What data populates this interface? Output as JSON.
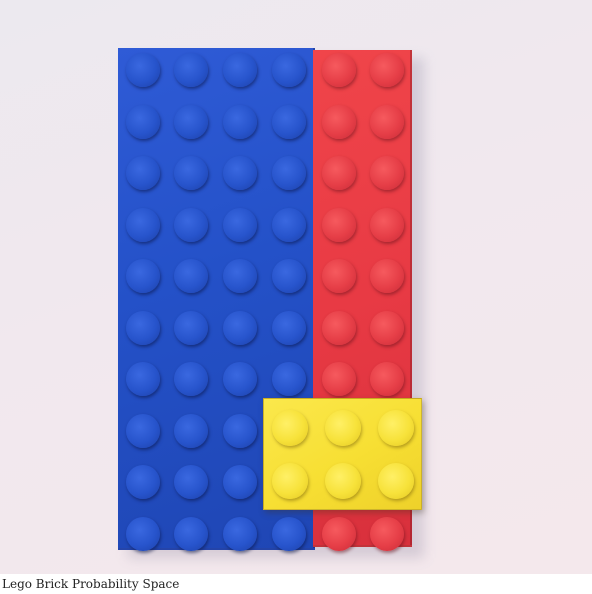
{
  "photo": {
    "subject": "lego-bricks-photo",
    "colors": {
      "blue_plate": "#2451c8",
      "red_plate": "#e83a44",
      "yellow_brick": "#f7df33",
      "background": "#efe9ee"
    }
  },
  "caption": "Lego Brick Probability Space"
}
